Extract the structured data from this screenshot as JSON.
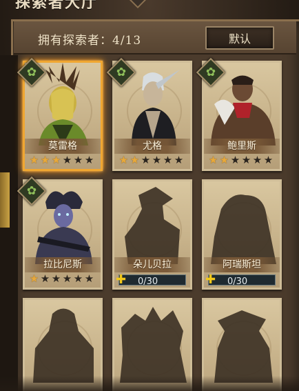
{
  "screen": {
    "title": "探索者大厅"
  },
  "header": {
    "owned_label": "拥有探索者：4/13",
    "default_button": "默认"
  },
  "colors": {
    "star_on": "#e8a93a",
    "star_off": "#2a241e",
    "selected_glow": "#ff9d1f",
    "shard_icon": "#f2c81a"
  },
  "cards": [
    {
      "name": "莫雷格",
      "owned": true,
      "selected": true,
      "stars": 3,
      "max_stars": 6,
      "badge": "leaf-emblem-icon"
    },
    {
      "name": "尤格",
      "owned": true,
      "selected": false,
      "stars": 2,
      "max_stars": 6,
      "badge": "leaf-emblem-icon"
    },
    {
      "name": "鲍里斯",
      "owned": true,
      "selected": false,
      "stars": 2,
      "max_stars": 6,
      "badge": "leaf-emblem-icon"
    },
    {
      "name": "拉比尼斯",
      "owned": true,
      "selected": false,
      "stars": 1,
      "max_stars": 6,
      "badge": "leaf-emblem-icon"
    },
    {
      "name": "朵儿贝拉",
      "owned": false,
      "shards": "0/30"
    },
    {
      "name": "阿瑞斯坦",
      "owned": false,
      "shards": "0/30"
    },
    {
      "name": "",
      "owned": false
    },
    {
      "name": "",
      "owned": false
    },
    {
      "name": "",
      "owned": false
    }
  ]
}
